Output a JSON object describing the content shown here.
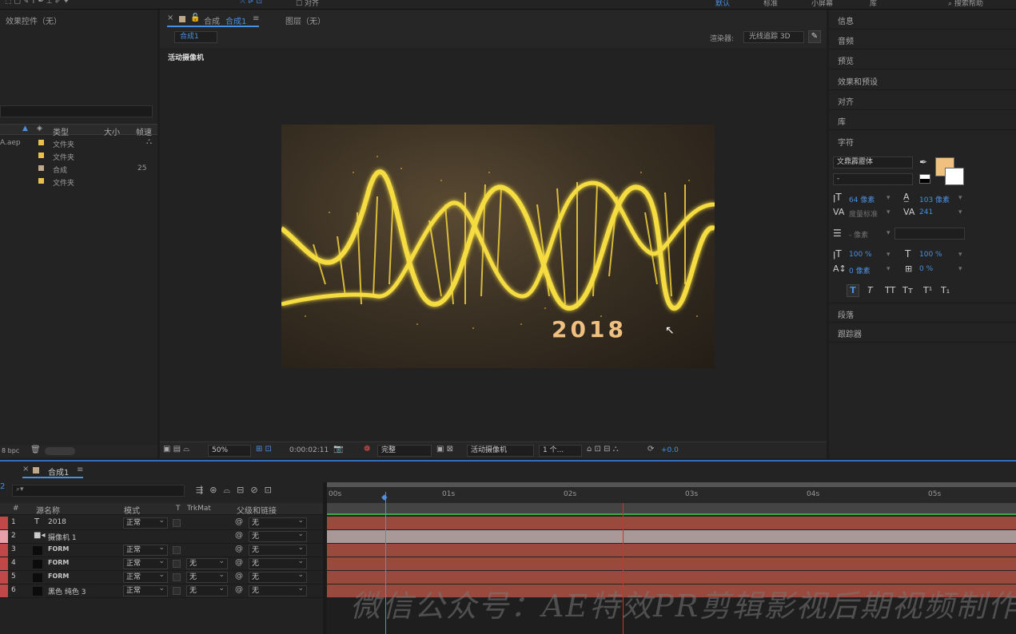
{
  "toolbar": {
    "align_label": "对齐",
    "workspaces": [
      "默认",
      "标准",
      "小屏幕",
      "库"
    ],
    "help_search": "搜索帮助"
  },
  "left_panel": {
    "effects_title": "效果控件（无）",
    "columns": {
      "type": "类型",
      "size": "大小",
      "fps": "帧速"
    },
    "rows": [
      {
        "name": "A.aep",
        "type": "文件夹",
        "size": "",
        "color": "#e8c24a"
      },
      {
        "name": "",
        "type": "文件夹",
        "size": "",
        "color": "#e8c24a"
      },
      {
        "name": "",
        "type": "合成",
        "size": "25",
        "color": "#bfa98a"
      },
      {
        "name": "",
        "type": "文件夹",
        "size": "",
        "color": "#e8c24a"
      }
    ],
    "bpc": "8 bpc"
  },
  "viewer": {
    "tab_label": "合成",
    "tab_comp": "合成1",
    "layer_tab": "图层（无）",
    "comp_chip": "合成1",
    "renderer_label": "渲染器:",
    "renderer_value": "光线追踪 3D",
    "camera_label": "活动摄像机",
    "comp_text": "2018",
    "footer": {
      "zoom": "50%",
      "timecode": "0:00:02:11",
      "quality": "完整",
      "view": "活动摄像机",
      "views_count": "1 个...",
      "exposure": "+0.0"
    }
  },
  "right_panel": {
    "items": [
      "信息",
      "音频",
      "预览",
      "效果和预设",
      "对齐",
      "库",
      "字符"
    ],
    "bottom_items": [
      "段落",
      "跟踪器"
    ],
    "character": {
      "font_family": "文鼎霹靂体",
      "font_style": "-",
      "font_size": "64 像素",
      "leading": "103 像素",
      "kerning": "度量标准",
      "tracking": "241",
      "stroke": "- 像素",
      "vert_scale": "100 %",
      "horiz_scale": "100 %",
      "baseline": "0 像素",
      "tsume": "0 %",
      "fill_color": "#f0c080"
    },
    "style_buttons": [
      "T",
      "T",
      "TT",
      "Tт",
      "T¹",
      "T₁"
    ]
  },
  "timeline": {
    "tab": "合成1",
    "columns": {
      "num": "#",
      "source": "源名称",
      "mode": "模式",
      "t": "T",
      "trkmat": "TrkMat",
      "parent": "父级和链接"
    },
    "ruler": [
      "00s",
      "01s",
      "02s",
      "03s",
      "04s",
      "05s"
    ],
    "layers": [
      {
        "num": "1",
        "name": "2018",
        "mode": "正常",
        "trkmat": "",
        "parent": "无",
        "label_color": "#c04848"
      },
      {
        "num": "2",
        "name": "摄像机 1",
        "mode": "",
        "trkmat": "",
        "parent": "无",
        "label_color": "#e8a0a8"
      },
      {
        "num": "3",
        "name": "FORM",
        "mode": "正常",
        "trkmat": "",
        "parent": "无",
        "label_color": "#c04848"
      },
      {
        "num": "4",
        "name": "FORM",
        "mode": "正常",
        "trkmat": "无",
        "parent": "无",
        "label_color": "#c04848"
      },
      {
        "num": "5",
        "name": "FORM",
        "mode": "正常",
        "trkmat": "无",
        "parent": "无",
        "label_color": "#c04848"
      },
      {
        "num": "6",
        "name": "黑色 纯色 3",
        "mode": "正常",
        "trkmat": "无",
        "parent": "无",
        "label_color": "#c04848"
      }
    ],
    "watermark": "微信公众号：AE特效PR剪辑影视后期视频制作"
  }
}
